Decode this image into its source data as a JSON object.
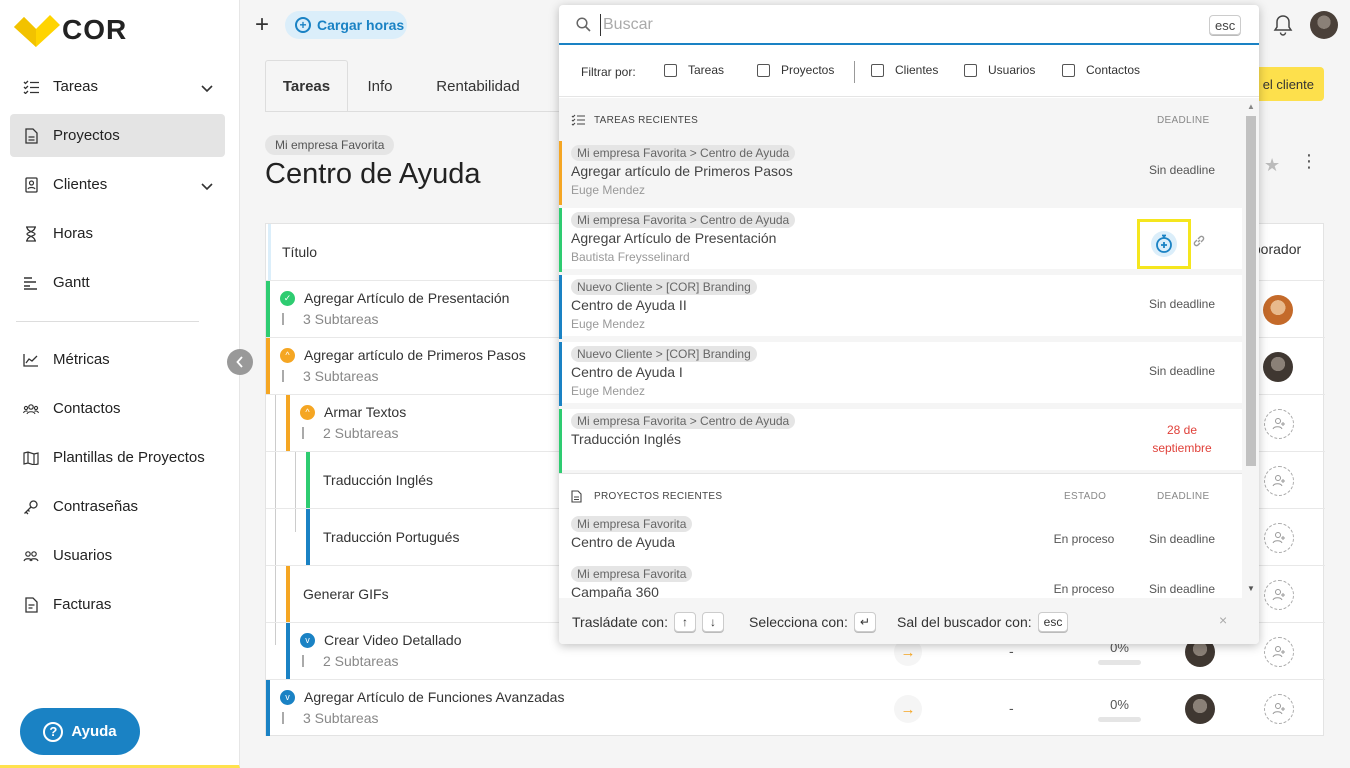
{
  "app": {
    "logo_text": "COR",
    "brand_color": "#ffd400",
    "accent_color": "#1a82c4"
  },
  "sidebar": {
    "items": [
      {
        "label": "Tareas",
        "icon": "task-list-icon"
      },
      {
        "label": "Proyectos",
        "icon": "project-file-icon"
      },
      {
        "label": "Clientes",
        "icon": "client-card-icon"
      },
      {
        "label": "Horas",
        "icon": "hourglass-icon"
      },
      {
        "label": "Gantt",
        "icon": "gantt-icon"
      },
      {
        "label": "Métricas",
        "icon": "metrics-chart-icon"
      },
      {
        "label": "Contactos",
        "icon": "contacts-icon"
      },
      {
        "label": "Plantillas de Proyectos",
        "icon": "map-template-icon"
      },
      {
        "label": "Contraseñas",
        "icon": "key-icon"
      },
      {
        "label": "Usuarios",
        "icon": "users-icon"
      },
      {
        "label": "Facturas",
        "icon": "invoice-icon"
      }
    ],
    "help_label": "Ayuda",
    "help_glyph": "?"
  },
  "topbar": {
    "plus": "+",
    "cargar_label": "Cargar horas",
    "client_button_label": "el cliente"
  },
  "tabs": [
    "Tareas",
    "Info",
    "Rentabilidad"
  ],
  "project": {
    "breadcrumb": "Mi empresa Favorita",
    "title": "Centro de Ayuda"
  },
  "table": {
    "col_title": "Título",
    "col_colab": "laborador",
    "rows": [
      {
        "title": "Agregar Artículo de Presentación",
        "subtasks": "3 Subtareas"
      },
      {
        "title": "Agregar artículo de Primeros Pasos",
        "subtasks": "3 Subtareas"
      },
      {
        "title": "Armar Textos",
        "subtasks": "2 Subtareas"
      },
      {
        "title": "Traducción Inglés",
        "subtasks": ""
      },
      {
        "title": "Traducción Portugués",
        "subtasks": ""
      },
      {
        "title": "Generar GIFs",
        "subtasks": ""
      },
      {
        "title": "Crear Video Detallado",
        "subtasks": "2 Subtareas",
        "dash": "-",
        "pct": "0%"
      },
      {
        "title": "Agregar Artículo de Funciones Avanzadas",
        "subtasks": "3 Subtareas",
        "dash": "-",
        "pct": "0%"
      }
    ]
  },
  "search": {
    "placeholder": "Buscar",
    "esc": "esc",
    "filter_label": "Filtrar por:",
    "filters": [
      "Tareas",
      "Proyectos",
      "Clientes",
      "Usuarios",
      "Contactos"
    ],
    "tasks_section": {
      "title": "TAREAS RECIENTES",
      "col_deadline": "DEADLINE"
    },
    "tasks": [
      {
        "path": "Mi empresa Favorita > Centro de Ayuda",
        "title": "Agregar artículo de Primeros Pasos",
        "person": "Euge Mendez",
        "deadline": "Sin deadline",
        "color": "#f5a623"
      },
      {
        "path": "Mi empresa Favorita > Centro de Ayuda",
        "title": "Agregar Artículo de Presentación",
        "person": "Bautista Freysselinard",
        "deadline": "",
        "color": "#2ecc71"
      },
      {
        "path": "Nuevo Cliente > [COR] Branding",
        "title": "Centro de Ayuda II",
        "person": "Euge Mendez",
        "deadline": "Sin deadline",
        "color": "#1a82c4"
      },
      {
        "path": "Nuevo Cliente > [COR] Branding",
        "title": "Centro de Ayuda I",
        "person": "Euge Mendez",
        "deadline": "Sin deadline",
        "color": "#1a82c4"
      },
      {
        "path": "Mi empresa Favorita > Centro de Ayuda",
        "title": "Traducción Inglés",
        "person": "",
        "deadline_day": "28 de",
        "deadline_month": "septiembre",
        "color": "#2ecc71"
      }
    ],
    "projects_section": {
      "title": "PROYECTOS RECIENTES",
      "col_estado": "ESTADO",
      "col_deadline": "DEADLINE"
    },
    "projects": [
      {
        "path": "Mi empresa Favorita",
        "title": "Centro de Ayuda",
        "estado": "En proceso",
        "deadline": "Sin deadline"
      },
      {
        "path": "Mi empresa Favorita",
        "title": "Campaña 360",
        "estado": "En proceso",
        "deadline": "Sin deadline"
      }
    ],
    "footer": {
      "move_label": "Trasládate con:",
      "up_key": "↑",
      "down_key": "↓",
      "select_label": "Selecciona con:",
      "enter_key": "↵",
      "exit_label": "Sal del buscador con:",
      "exit_key": "esc",
      "close": "×"
    }
  }
}
